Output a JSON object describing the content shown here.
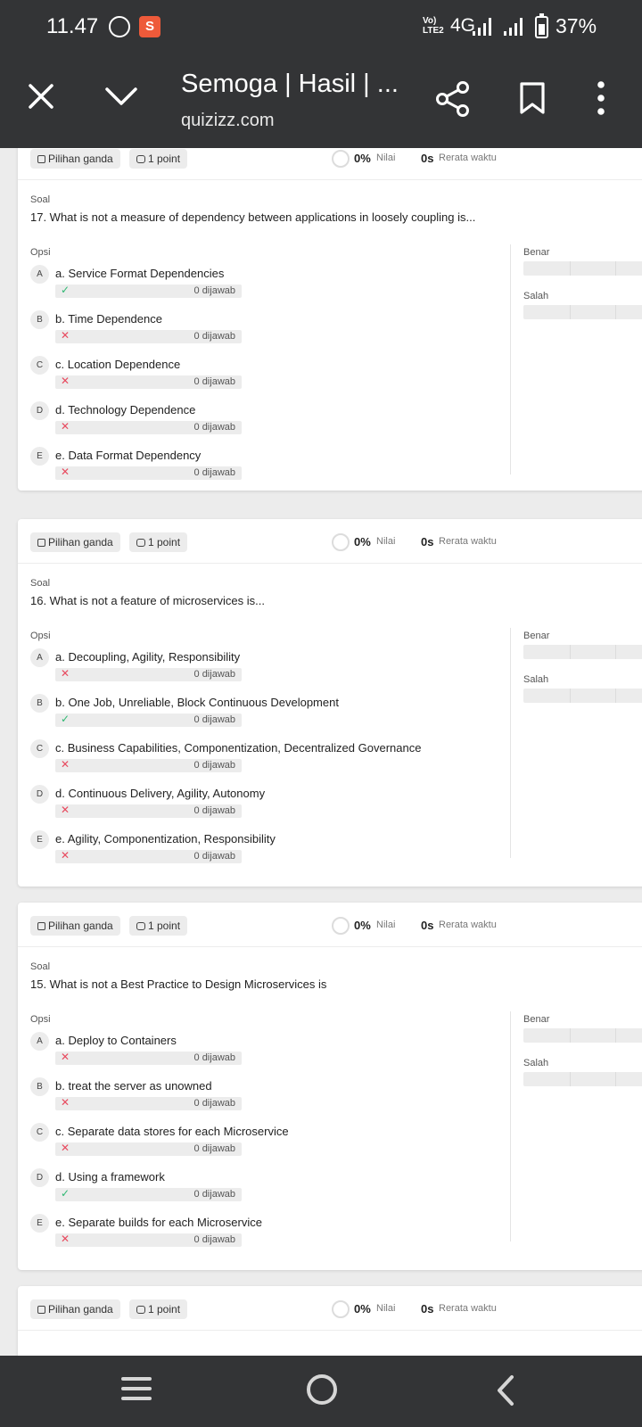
{
  "status_bar": {
    "time": "11.47",
    "network": "4G",
    "battery": "37%"
  },
  "browser": {
    "title": "Semoga | Hasil | ...",
    "url": "quizizz.com"
  },
  "colors": {
    "dark_bar": "#333436",
    "correct": "#2fb872",
    "wrong": "#e84a5f"
  },
  "labels": {
    "type": "Pilihan ganda",
    "points": "1 point",
    "score_pct": "0%",
    "score_label": "Nilai",
    "time_val": "0s",
    "time_label": "Rerata waktu",
    "soal": "Soal",
    "opsi": "Opsi",
    "benar": "Benar",
    "salah": "Salah"
  },
  "questions": [
    {
      "text": "17. What is not a measure of dependency between applications in loosely coupling is...",
      "options": [
        {
          "letter": "A",
          "text": "a. Service Format Dependencies",
          "correct": true,
          "mark": "✓",
          "count": "0 dijawab"
        },
        {
          "letter": "B",
          "text": "b. Time Dependence",
          "correct": false,
          "mark": "✕",
          "count": "0 dijawab"
        },
        {
          "letter": "C",
          "text": "c. Location Dependence",
          "correct": false,
          "mark": "✕",
          "count": "0 dijawab"
        },
        {
          "letter": "D",
          "text": "d. Technology Dependence",
          "correct": false,
          "mark": "✕",
          "count": "0 dijawab"
        },
        {
          "letter": "E",
          "text": "e. Data Format Dependency",
          "correct": false,
          "mark": "✕",
          "count": "0 dijawab"
        }
      ]
    },
    {
      "text": "16. What is not a feature of microservices is...",
      "options": [
        {
          "letter": "A",
          "text": "a. Decoupling, Agility, Responsibility",
          "correct": false,
          "mark": "✕",
          "count": "0 dijawab"
        },
        {
          "letter": "B",
          "text": "b. One Job, Unreliable, Block Continuous Development",
          "correct": true,
          "mark": "✓",
          "count": "0 dijawab"
        },
        {
          "letter": "C",
          "text": "c. Business Capabilities, Componentization, Decentralized Governance",
          "correct": false,
          "mark": "✕",
          "count": "0 dijawab"
        },
        {
          "letter": "D",
          "text": "d. Continuous Delivery, Agility, Autonomy",
          "correct": false,
          "mark": "✕",
          "count": "0 dijawab"
        },
        {
          "letter": "E",
          "text": "e. Agility, Componentization, Responsibility",
          "correct": false,
          "mark": "✕",
          "count": "0 dijawab"
        }
      ]
    },
    {
      "text": "15. What is not a Best Practice to Design Microservices is",
      "options": [
        {
          "letter": "A",
          "text": "a. Deploy to Containers",
          "correct": false,
          "mark": "✕",
          "count": "0 dijawab"
        },
        {
          "letter": "B",
          "text": "b. treat the server as unowned",
          "correct": false,
          "mark": "✕",
          "count": "0 dijawab"
        },
        {
          "letter": "C",
          "text": "c. Separate data stores for each Microservice",
          "correct": false,
          "mark": "✕",
          "count": "0 dijawab"
        },
        {
          "letter": "D",
          "text": "d. Using a framework",
          "correct": true,
          "mark": "✓",
          "count": "0 dijawab"
        },
        {
          "letter": "E",
          "text": "e. Separate builds for each Microservice",
          "correct": false,
          "mark": "✕",
          "count": "0 dijawab"
        }
      ]
    }
  ]
}
